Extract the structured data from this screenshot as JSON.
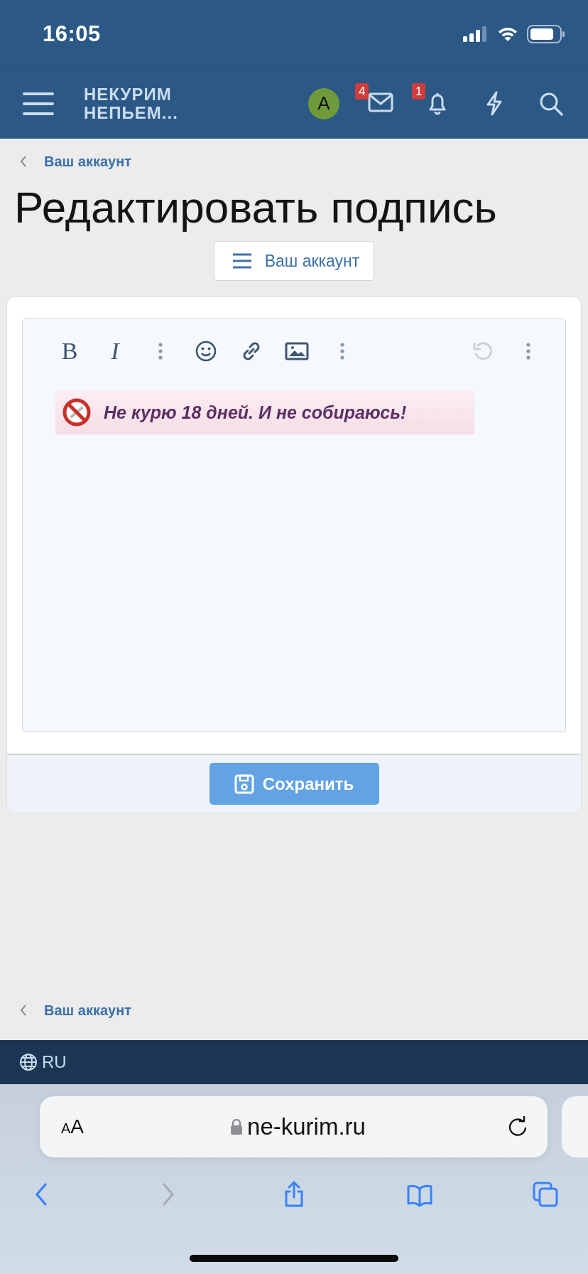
{
  "status_bar": {
    "time": "16:05"
  },
  "header": {
    "logo": [
      "НЕКУРИМ",
      "НЕПЬЕМ..."
    ],
    "nav": [
      {
        "kind": "avatar",
        "label": "A",
        "color": "#6f9a3a"
      },
      {
        "kind": "inbox",
        "badge": "4"
      },
      {
        "kind": "alerts",
        "badge": "1"
      },
      {
        "kind": "whats-new"
      },
      {
        "kind": "search"
      }
    ]
  },
  "breadcrumb": {
    "label": "Ваш аккаунт"
  },
  "title": "Редактировать подпись",
  "menu_button": {
    "label": "Ваш аккаунт"
  },
  "editor": {
    "toolbar": [
      {
        "kind": "text",
        "label": "B",
        "disabled": false
      },
      {
        "kind": "text",
        "label": "I",
        "disabled": false
      },
      {
        "kind": "more",
        "disabled": false
      },
      {
        "kind": "smilie",
        "disabled": false
      },
      {
        "kind": "link",
        "disabled": false
      },
      {
        "kind": "image",
        "disabled": false
      },
      {
        "kind": "more",
        "disabled": false
      },
      {
        "kind": "undo",
        "disabled": true
      },
      {
        "kind": "more",
        "disabled": false
      }
    ],
    "signature": {
      "text": "Не курю 18 дней. И не собираюсь!"
    }
  },
  "save_button": {
    "label": "Сохранить"
  },
  "breadcrumb_bottom": {
    "label": "Ваш аккаунт"
  },
  "footer": {
    "language": "RU"
  },
  "browser": {
    "text_size": {
      "small": "A",
      "large": "A"
    },
    "url": "ne-kurim.ru",
    "toolbar": [
      {
        "kind": "back",
        "disabled": false
      },
      {
        "kind": "forward",
        "disabled": true
      },
      {
        "kind": "share",
        "disabled": false
      },
      {
        "kind": "bookmarks",
        "disabled": false
      },
      {
        "kind": "tabs",
        "disabled": false
      }
    ]
  }
}
